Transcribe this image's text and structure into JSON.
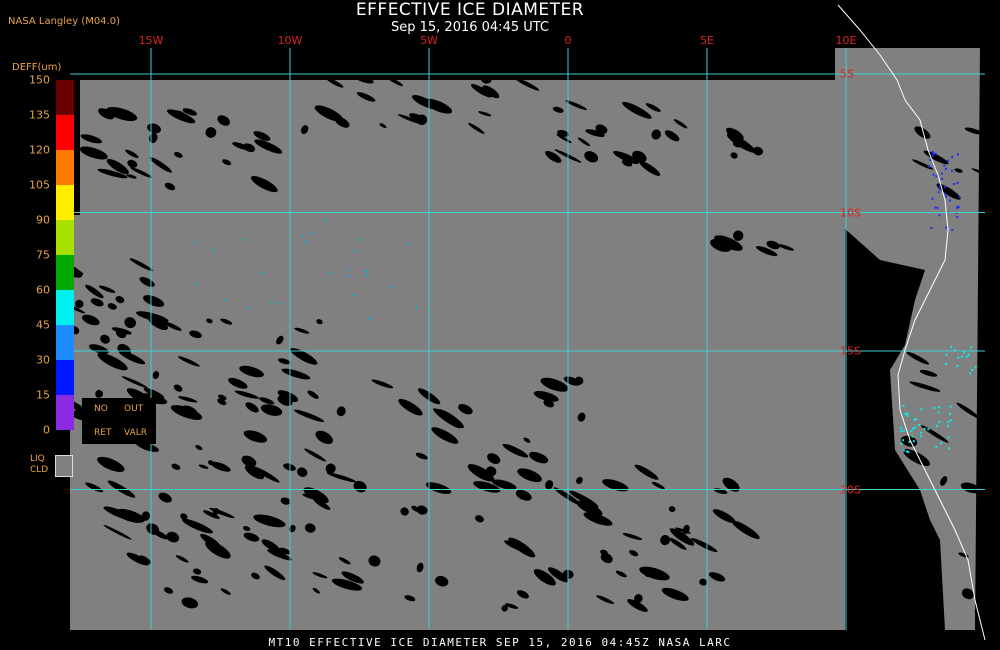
{
  "header": {
    "title": "EFFECTIVE ICE DIAMETER",
    "subtitle": "Sep 15, 2016 04:45 UTC",
    "credit": "NASA Langley (M04.0)"
  },
  "footer": "MT10  EFFECTIVE ICE DIAMETER  SEP 15, 2016 04:45Z  NASA LARC",
  "colors": {
    "background": "#000000",
    "liquid_cloud": "#808080",
    "grid": "#3fd0d0",
    "coast": "#ffffff",
    "label_red": "#dd2222",
    "label_orange": "#e8a24a"
  },
  "grid": {
    "longitudes": [
      {
        "label": "15W",
        "lon": -15
      },
      {
        "label": "10W",
        "lon": -10
      },
      {
        "label": "5W",
        "lon": -5
      },
      {
        "label": "0",
        "lon": 0
      },
      {
        "label": "5E",
        "lon": 5
      },
      {
        "label": "10E",
        "lon": 10
      }
    ],
    "latitudes": [
      {
        "label": "5S",
        "lat": -5
      },
      {
        "label": "10S",
        "lat": -10
      },
      {
        "label": "15S",
        "lat": -15
      },
      {
        "label": "20S",
        "lat": -20
      }
    ]
  },
  "colorbar": {
    "title": "DEFF(um)",
    "ticks": [
      "150",
      "135",
      "120",
      "105",
      "90",
      "75",
      "60",
      "45",
      "30",
      "15",
      "0"
    ],
    "colors": [
      "#6a0000",
      "#ff0000",
      "#ff7a00",
      "#ffee00",
      "#a8e000",
      "#00a800",
      "#00f0f0",
      "#1e8cff",
      "#0018ff",
      "#8a2be2"
    ],
    "no_retrieval": {
      "line1a": "NO",
      "line1b": "OUT",
      "line2a": "RET",
      "line2b": "VALR"
    },
    "liquid_cloud": {
      "line1": "LIQ",
      "line2": "CLD"
    }
  }
}
